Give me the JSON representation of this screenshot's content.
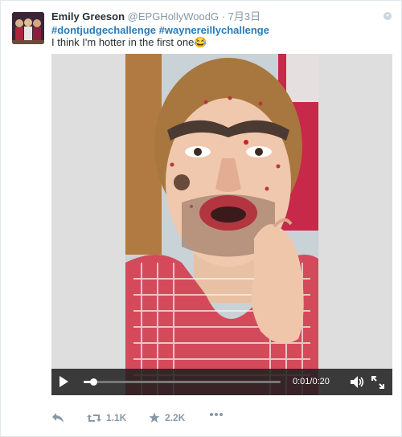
{
  "tweet": {
    "fullname": "Emily Greeson",
    "handle": "@EPGHollyWoodG",
    "separator": "·",
    "time": "7月3日",
    "hashtags": [
      "#dontjudgechallenge",
      "#waynereillychallenge"
    ],
    "text": "I think I'm hotter in the first one😂"
  },
  "video": {
    "time_current": "0:01",
    "time_total": "0:20",
    "time_separator": "/",
    "progress_fraction": 0.05
  },
  "actions": {
    "reply_icon": "reply-icon",
    "retweet_count": "1.1K",
    "like_count": "2.2K",
    "more_icon": "more-icon"
  },
  "colors": {
    "link": "#2b7bb9",
    "muted": "#8899a6",
    "text": "#292f33"
  }
}
